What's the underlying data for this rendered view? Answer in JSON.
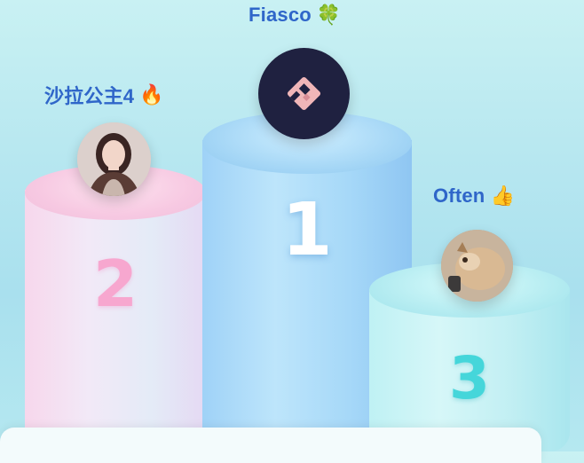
{
  "leaderboard": {
    "first": {
      "rank": "1",
      "name": "Fiasco",
      "badge_icon": "clover-icon",
      "badge_glyph": "🍀"
    },
    "second": {
      "rank": "2",
      "name": "沙拉公主4",
      "badge_icon": "fire-icon",
      "badge_glyph": "🔥"
    },
    "third": {
      "rank": "3",
      "name": "Often",
      "badge_icon": "thumbs-up-icon",
      "badge_glyph": "👍"
    }
  },
  "colors": {
    "name_text": "#2f66c9",
    "podium_1": "#a6d8f8",
    "podium_2": "#f7c9e2",
    "podium_3": "#b5ecf1",
    "rank_2_number": "#f7a7cf",
    "rank_3_number": "#45d6da"
  }
}
